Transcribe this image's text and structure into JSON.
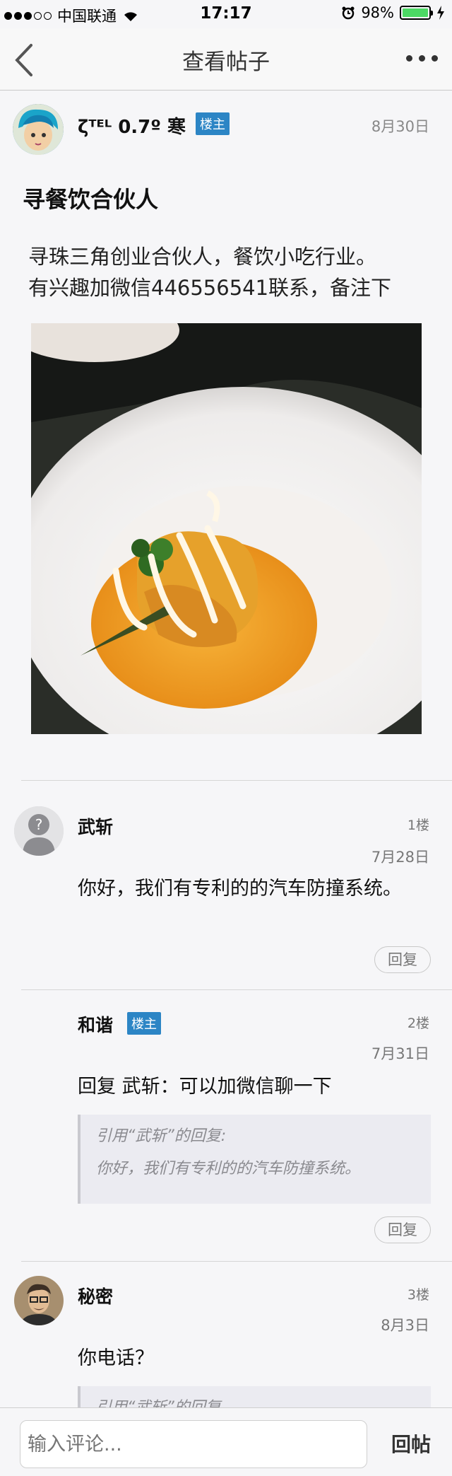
{
  "status_bar": {
    "carrier": "中国联通",
    "time": "17:17",
    "battery": "98%",
    "battery_level": 0.98
  },
  "nav": {
    "title": "查看帖子"
  },
  "post": {
    "author": "ζᵀᴱᴸ 0.7º 寒",
    "author_badge": "楼主",
    "date": "8月30日",
    "title": "寻餐饮合伙人",
    "body_line1": "寻珠三角创业合伙人，餐饮小吃行业。",
    "body_line2": "有兴趣加微信446556541联系，备注下"
  },
  "comments": [
    {
      "name": "武斩",
      "floor": "1楼",
      "date": "7月28日",
      "body": "你好，我们有专利的的汽车防撞系统。",
      "reply_label": "回复"
    },
    {
      "name": "和谐",
      "badge": "楼主",
      "floor": "2楼",
      "date": "7月31日",
      "body": "回复 武斩：可以加微信聊一下",
      "quote_title": "引用“武斩”的回复:",
      "quote_text": "你好，我们有专利的的汽车防撞系统。",
      "reply_label": "回复"
    },
    {
      "name": "秘密",
      "floor": "3楼",
      "date": "8月3日",
      "body": "你电话？",
      "quote_title": "引用“武斩”的回复"
    }
  ],
  "bottom_bar": {
    "input_placeholder": "输入评论...",
    "submit_label": "回帖"
  },
  "colors": {
    "badge": "#2c85c5",
    "battery": "#4cd964"
  }
}
